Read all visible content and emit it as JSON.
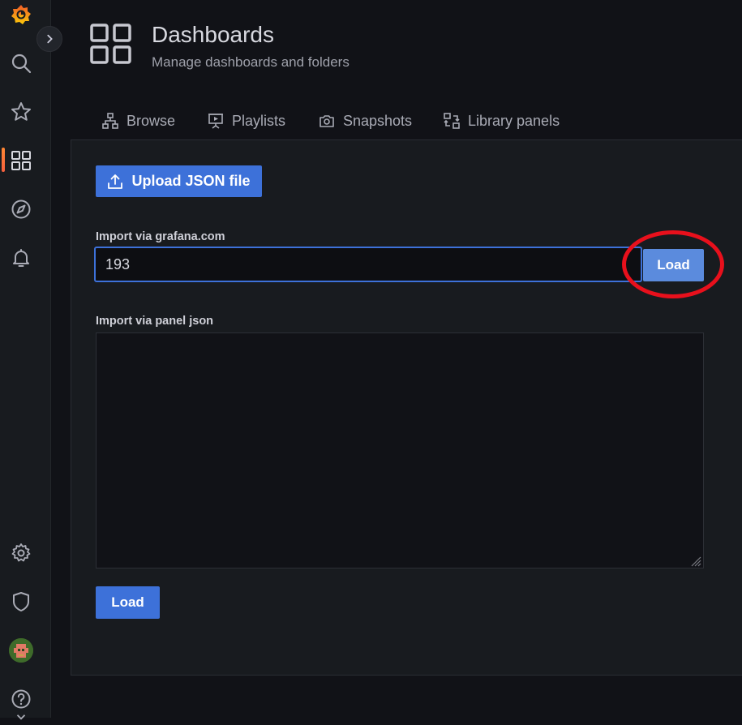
{
  "header": {
    "title": "Dashboards",
    "subtitle": "Manage dashboards and folders"
  },
  "tabs": [
    {
      "label": "Browse",
      "icon": "sitemap-icon"
    },
    {
      "label": "Playlists",
      "icon": "presentation-icon"
    },
    {
      "label": "Snapshots",
      "icon": "camera-icon"
    },
    {
      "label": "Library panels",
      "icon": "library-panels-icon"
    }
  ],
  "sidebar": {
    "items": [
      "grafana-logo",
      "search",
      "starred",
      "dashboards",
      "explore",
      "alerting",
      "configuration",
      "server-admin",
      "profile",
      "help"
    ],
    "active": "dashboards"
  },
  "upload": {
    "label": "Upload JSON file"
  },
  "grafana_import": {
    "label": "Import via grafana.com",
    "value": "193",
    "button": "Load"
  },
  "json_import": {
    "label": "Import via panel json",
    "value": "",
    "button": "Load"
  },
  "colors": {
    "primary": "#3d71d9",
    "highlight": "#e8101c",
    "brand": "#f55f3e"
  }
}
